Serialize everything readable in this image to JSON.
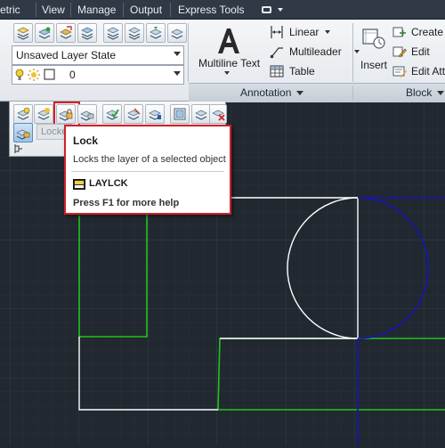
{
  "menu": {
    "items": [
      "etric",
      "View",
      "Manage",
      "Output",
      "Express Tools"
    ]
  },
  "layers_panel": {
    "layer_state": "Unsaved Layer State",
    "current_layer": "0"
  },
  "annotation_panel": {
    "title": "Annotation",
    "multiline_text": "Multiline Text",
    "linear": "Linear",
    "multileader": "Multileader",
    "table": "Table"
  },
  "block_panel": {
    "title": "Block",
    "insert": "Insert",
    "create": "Create",
    "edit": "Edit",
    "edit_attributes": "Edit Att"
  },
  "float_panel": {
    "locked_field": "Locke"
  },
  "tooltip": {
    "title": "Lock",
    "description": "Locks the layer of a selected object",
    "command": "LAYLCK",
    "help": "Press F1 for more help"
  },
  "colors": {
    "canvas_bg": "#212830",
    "grid": "#2e3743",
    "white_geometry": "#ffffff",
    "green_geometry": "#21c41d",
    "blue_geometry": "#1010b0",
    "highlight_red": "#d0202a"
  },
  "icons": {
    "app_toggle": "app-toggle-icon",
    "lightbulb": "lightbulb-icon",
    "sun": "sun-icon",
    "color_square": "color-square-icon",
    "tooltip_command": "laylck-command-icon"
  }
}
